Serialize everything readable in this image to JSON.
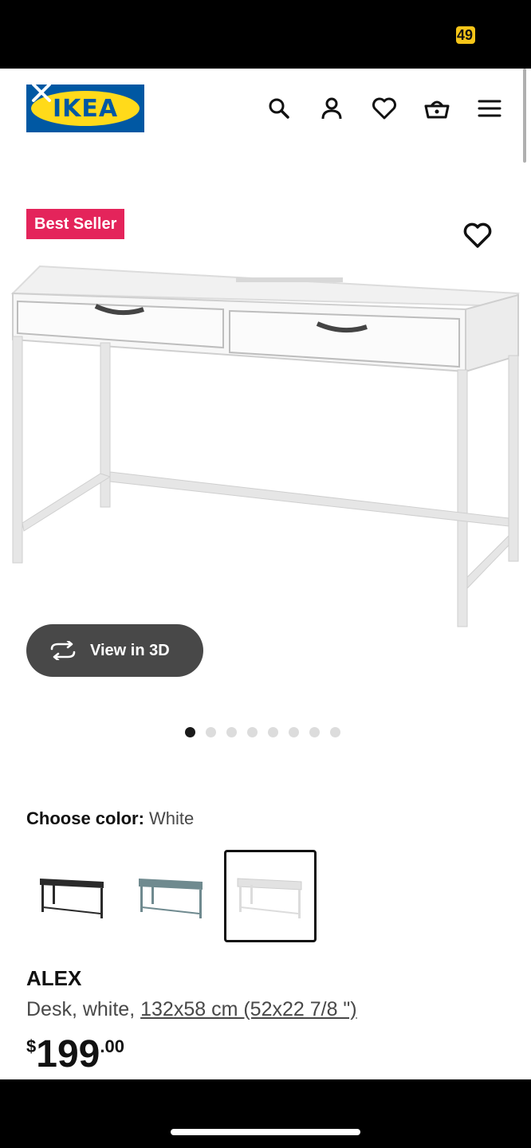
{
  "status_bar": {
    "badge": "49"
  },
  "header": {
    "logo_text": "IKEA",
    "icons": [
      "search-icon",
      "account-icon",
      "heart-icon",
      "basket-icon",
      "menu-icon"
    ]
  },
  "product": {
    "badge": "Best Seller",
    "view_3d_label": "View in 3D",
    "carousel_dots": 8,
    "carousel_active": 0,
    "choose_color_label": "Choose color:",
    "selected_color": "White",
    "swatches": [
      {
        "name": "Black",
        "color": "#2a2a2a"
      },
      {
        "name": "Blue-gray",
        "color": "#6f8a8f"
      },
      {
        "name": "White",
        "color": "#ececec",
        "selected": true
      }
    ],
    "name": "ALEX",
    "desc_prefix": "Desk, white, ",
    "dimensions_link": "132x58 cm (52x22 7/8 \")",
    "price_currency": "$",
    "price_main": "199",
    "price_cents": ".00"
  },
  "colors": {
    "brand_blue": "#0058a3",
    "brand_yellow": "#ffda1a",
    "badge_red": "#e4245b"
  }
}
